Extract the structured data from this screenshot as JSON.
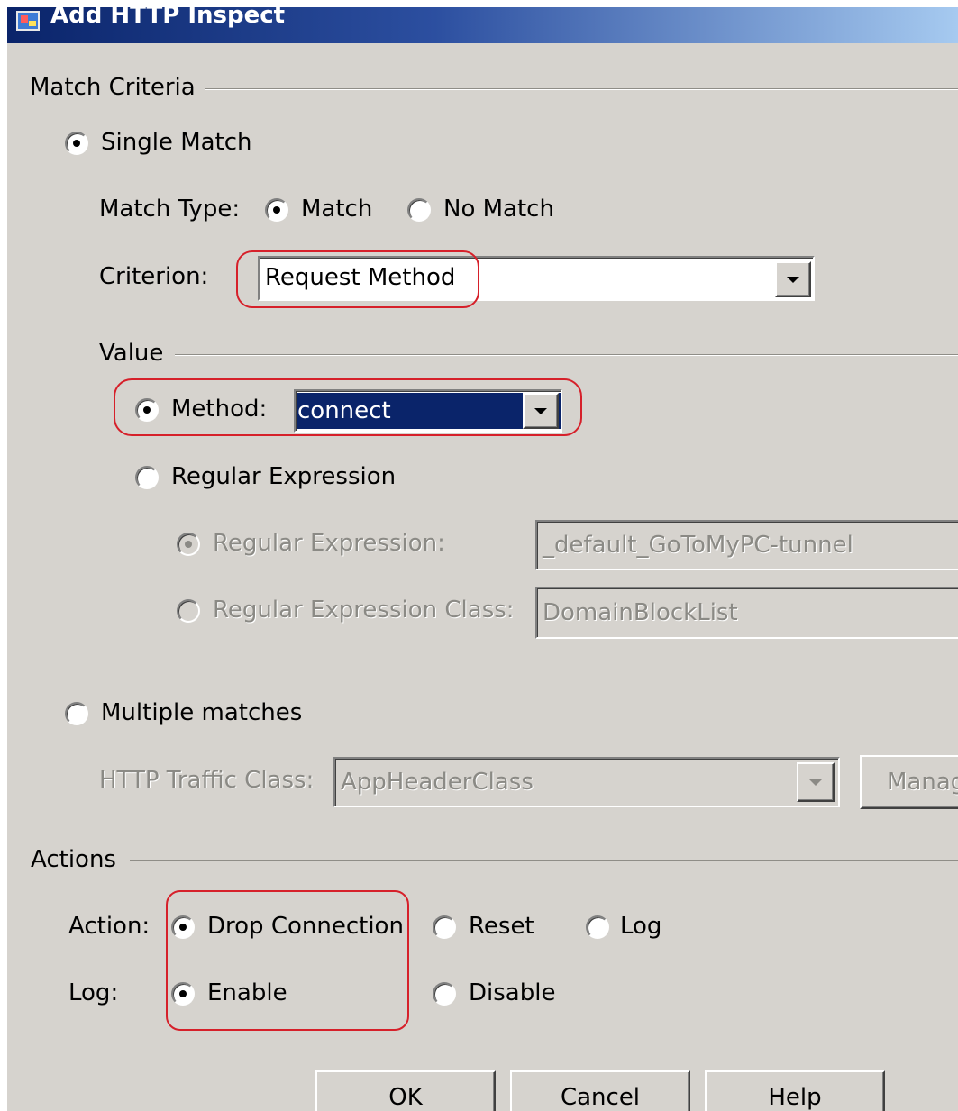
{
  "window": {
    "title": "Add HTTP Inspect"
  },
  "match_criteria": {
    "legend": "Match Criteria",
    "single_match_label": "Single Match",
    "single_match_selected": true,
    "match_type": {
      "label": "Match Type:",
      "match_label": "Match",
      "no_match_label": "No Match",
      "selected": "Match"
    },
    "criterion": {
      "label": "Criterion:",
      "value": "Request Method"
    },
    "value_group": {
      "legend": "Value",
      "method_label": "Method:",
      "method_value": "connect",
      "regex_label": "Regular Expression",
      "regex_sub_label": "Regular Expression:",
      "regex_sub_value": "_default_GoToMyPC-tunnel",
      "regex_class_label": "Regular Expression Class:",
      "regex_class_value": "DomainBlockList"
    },
    "multiple_matches_label": "Multiple matches",
    "http_traffic_class": {
      "label": "HTTP Traffic Class:",
      "value": "AppHeaderClass"
    },
    "manage_label": "Manag"
  },
  "actions": {
    "legend": "Actions",
    "action_label": "Action:",
    "drop_connection_label": "Drop Connection",
    "reset_label": "Reset",
    "log_option_label": "Log",
    "log_label": "Log:",
    "enable_label": "Enable",
    "disable_label": "Disable"
  },
  "buttons": {
    "ok": "OK",
    "cancel": "Cancel",
    "help": "Help"
  },
  "colors": {
    "dialog_bg": "#d6d3ce",
    "title_bar": "#0a246a",
    "highlight": "#d6202a",
    "selection": "#0a246a"
  }
}
